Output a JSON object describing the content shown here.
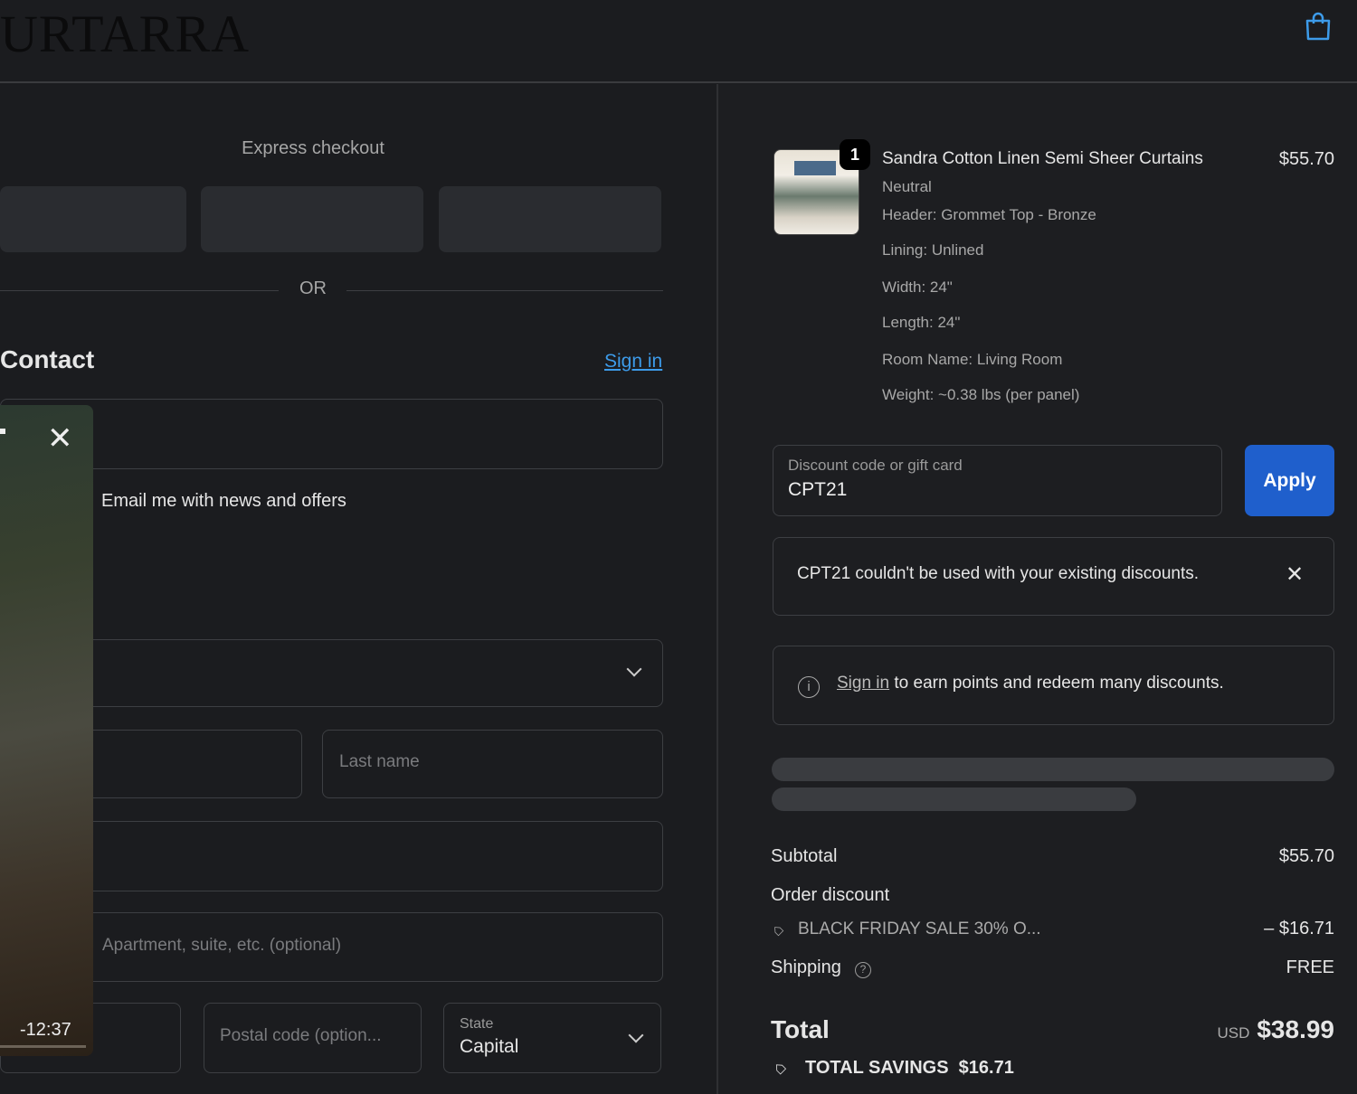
{
  "header": {
    "logo": "URTARRA",
    "cart_icon": "shopping-bag-icon"
  },
  "express": {
    "title": "Express checkout",
    "or": "OR"
  },
  "contact": {
    "heading": "Contact",
    "sign_in": "Sign in",
    "newsletter": "Email me with news and offers"
  },
  "delivery": {
    "last_name_placeholder": "Last name",
    "apartment_placeholder": "Apartment, suite, etc. (optional)",
    "postal_placeholder": "Postal code (option...",
    "state_label": "State",
    "state_value": "Capital"
  },
  "video": {
    "time": "-12:37"
  },
  "product": {
    "quantity": "1",
    "title": "Sandra Cotton Linen Semi Sheer Curtains",
    "price": "$55.70",
    "variants": [
      "Neutral",
      "Header: Grommet Top - Bronze",
      "Lining: Unlined",
      "Width: 24\"",
      "Length: 24\"",
      "Room Name: Living Room",
      "Weight: ~0.38 lbs (per panel)"
    ]
  },
  "discount": {
    "label": "Discount code or gift card",
    "value": "CPT21",
    "apply": "Apply",
    "error": "CPT21 couldn't be used with your existing discounts.",
    "info_link": "Sign in",
    "info_text": " to earn points and redeem many discounts."
  },
  "summary": {
    "subtotal_label": "Subtotal",
    "subtotal": "$55.70",
    "order_discount_label": "Order discount",
    "discount_name": "BLACK FRIDAY SALE 30% O...",
    "discount_amount": "– $16.71",
    "shipping_label": "Shipping",
    "shipping": "FREE",
    "total_label": "Total",
    "currency": "USD",
    "total": "$38.99",
    "savings_label": "TOTAL SAVINGS",
    "savings": "$16.71"
  },
  "colors": {
    "accent": "#3d9be9",
    "apply_bg": "#1f5fcc"
  }
}
